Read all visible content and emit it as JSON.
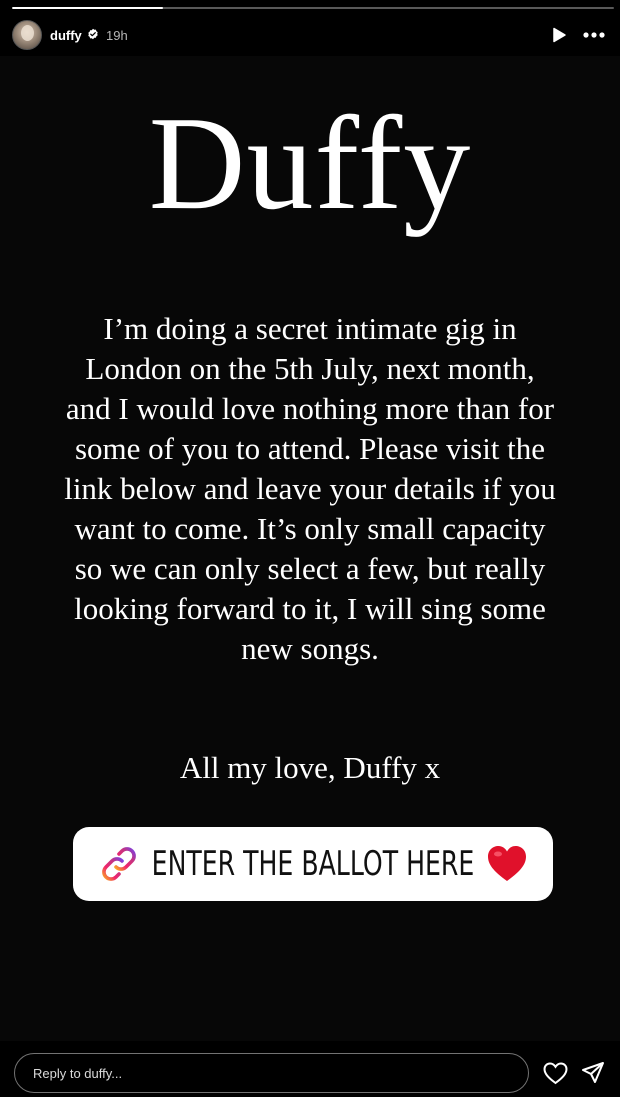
{
  "progress": {
    "fraction": 0.25
  },
  "header": {
    "username": "duffy",
    "verified": true,
    "timestamp": "19h",
    "play_icon": "play-icon",
    "more_icon": "more-horizontal-icon"
  },
  "story": {
    "title": "Duffy",
    "body": "I’m doing a secret intimate gig in London on the 5th July, next month, and I would love nothing more than for some of you to attend. Please visit the link below and leave your details if you want to come. It’s only small capacity so we can only select a few, but really looking forward to it, I will sing some new songs.",
    "signoff": "All my love, Duffy x",
    "link_sticker": {
      "label": "ENTER THE BALLOT HERE",
      "link_icon": "link-icon",
      "emoji_icon": "red-heart-icon"
    }
  },
  "reply": {
    "placeholder": "Reply to duffy...",
    "like_icon": "heart-outline-icon",
    "share_icon": "send-icon"
  },
  "colors": {
    "background": "#000000",
    "sticker_background": "#ffffff",
    "heart": "#e0112b"
  }
}
